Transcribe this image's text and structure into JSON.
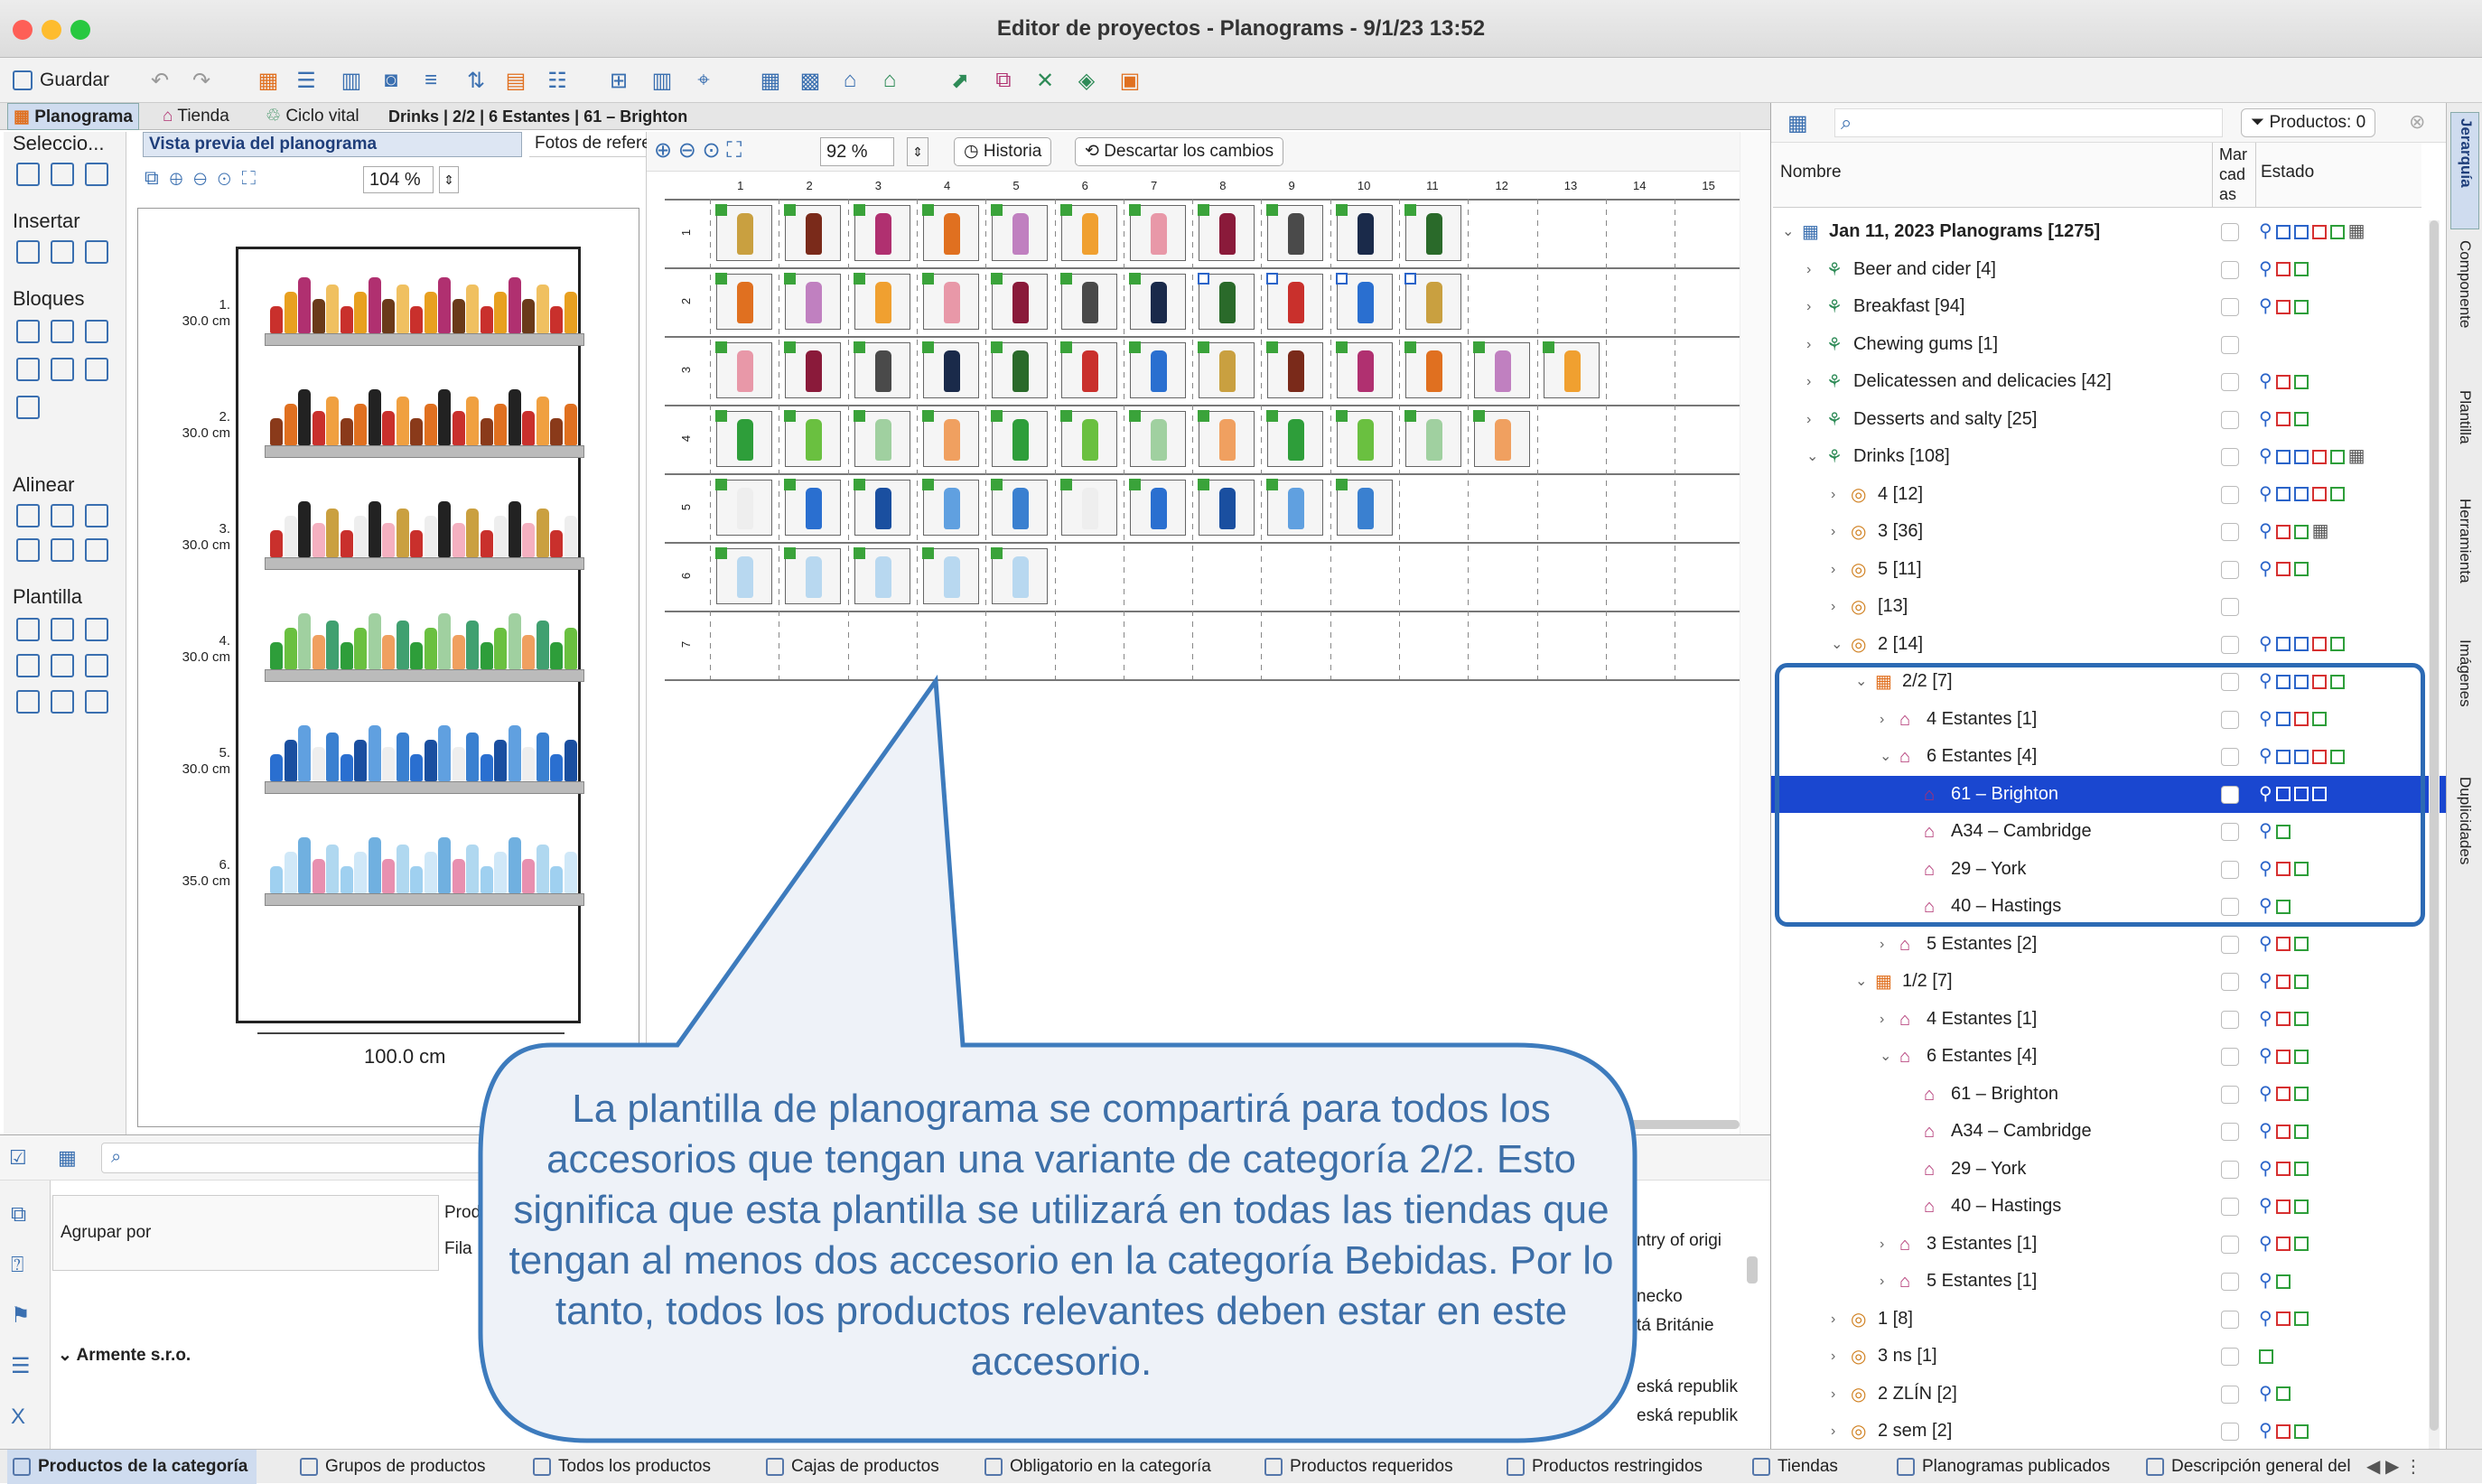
{
  "window": {
    "title": "Editor de proyectos - Planograms - 9/1/23 13:52"
  },
  "toolbar": {
    "save_label": "Guardar"
  },
  "tabs": {
    "planograma": "Planograma",
    "tienda": "Tienda",
    "ciclo": "Ciclo vital",
    "crumb": "Drinks | 2/2 | 6 Estantes | 61 – Brighton"
  },
  "palette": {
    "seleccion": "Seleccio...",
    "insertar": "Insertar",
    "bloques": "Bloques",
    "alinear": "Alinear",
    "plantilla": "Plantilla"
  },
  "preview": {
    "tab_active": "Vista previa del planograma",
    "tab_other": "Fotos de referencia",
    "zoom": "104 %",
    "width_label": "100.0 cm",
    "shelves": [
      {
        "n": "1.",
        "h": "30.0 cm"
      },
      {
        "n": "2.",
        "h": "30.0 cm"
      },
      {
        "n": "3.",
        "h": "30.0 cm"
      },
      {
        "n": "4.",
        "h": "30.0 cm"
      },
      {
        "n": "5.",
        "h": "30.0 cm"
      },
      {
        "n": "6.",
        "h": "35.0 cm"
      }
    ]
  },
  "canvas": {
    "zoom": "92 %",
    "historia": "Historia",
    "descartar": "Descartar los cambios",
    "cols": [
      "1",
      "2",
      "3",
      "4",
      "5",
      "6",
      "7",
      "8",
      "9",
      "10",
      "11",
      "12",
      "13",
      "14",
      "15"
    ],
    "rows": [
      "1",
      "2",
      "3",
      "4",
      "5",
      "6",
      "7"
    ],
    "row_counts": [
      11,
      11,
      13,
      12,
      10,
      5,
      0
    ]
  },
  "callout": {
    "text": "La plantilla de planograma se compartirá para todos los accesorios que tengan una variante de categoría 2/2. Esto significa que esta plantilla se utilizará en todas las tiendas que tengan al menos dos accesorio en la categoría Bebidas. Por lo tanto, todos los productos relevantes deben estar en este accesorio."
  },
  "right": {
    "productos": "Productos: 0",
    "col_nombre": "Nombre",
    "col_marcadas_1": "Mar",
    "col_marcadas_2": "cad",
    "col_marcadas_3": "as",
    "col_estado": "Estado",
    "tree": [
      {
        "label": "Jan 11, 2023 Planograms [1275]",
        "lvl": 0,
        "exp": "v",
        "bold": true,
        "icon": "root",
        "st": "BBRGT"
      },
      {
        "label": "Beer and cider [4]",
        "lvl": 1,
        "exp": ">",
        "icon": "cat",
        "st": "RG"
      },
      {
        "label": "Breakfast [94]",
        "lvl": 1,
        "exp": ">",
        "icon": "cat",
        "st": "RG"
      },
      {
        "label": "Chewing gums [1]",
        "lvl": 1,
        "exp": ">",
        "icon": "cat",
        "st": ""
      },
      {
        "label": "Delicatessen and delicacies [42]",
        "lvl": 1,
        "exp": ">",
        "icon": "cat",
        "st": "RG"
      },
      {
        "label": "Desserts and salty [25]",
        "lvl": 1,
        "exp": ">",
        "icon": "cat",
        "st": "RG"
      },
      {
        "label": "Drinks [108]",
        "lvl": 1,
        "exp": "v",
        "icon": "cat",
        "st": "BBRGT"
      },
      {
        "label": "4 [12]",
        "lvl": 2,
        "exp": ">",
        "icon": "var",
        "st": "BBRG"
      },
      {
        "label": "3 [36]",
        "lvl": 2,
        "exp": ">",
        "icon": "var",
        "st": "RGT"
      },
      {
        "label": "5 [11]",
        "lvl": 2,
        "exp": ">",
        "icon": "var",
        "st": "RG"
      },
      {
        "label": "[13]",
        "lvl": 2,
        "exp": ">",
        "icon": "var",
        "st": ""
      },
      {
        "label": "2 [14]",
        "lvl": 2,
        "exp": "v",
        "icon": "var",
        "st": "BBRG"
      },
      {
        "label": "2/2 [7]",
        "lvl": 3,
        "exp": "v",
        "icon": "tpl",
        "st": "BBRG"
      },
      {
        "label": "4 Estantes [1]",
        "lvl": 4,
        "exp": ">",
        "icon": "store",
        "st": "BRG"
      },
      {
        "label": "6 Estantes [4]",
        "lvl": 4,
        "exp": "v",
        "icon": "store",
        "st": "BBRG"
      },
      {
        "label": "61 – Brighton",
        "lvl": 5,
        "exp": "",
        "icon": "store",
        "st": "BBB",
        "sel": true
      },
      {
        "label": "A34 – Cambridge",
        "lvl": 5,
        "exp": "",
        "icon": "store",
        "st": "G"
      },
      {
        "label": "29 – York",
        "lvl": 5,
        "exp": "",
        "icon": "store",
        "st": "RG"
      },
      {
        "label": "40 – Hastings",
        "lvl": 5,
        "exp": "",
        "icon": "store",
        "st": "G"
      },
      {
        "label": "5 Estantes [2]",
        "lvl": 4,
        "exp": ">",
        "icon": "store",
        "st": "RG"
      },
      {
        "label": "1/2 [7]",
        "lvl": 3,
        "exp": "v",
        "icon": "tpl",
        "st": "RG"
      },
      {
        "label": "4 Estantes [1]",
        "lvl": 4,
        "exp": ">",
        "icon": "store",
        "st": "RG"
      },
      {
        "label": "6 Estantes [4]",
        "lvl": 4,
        "exp": "v",
        "icon": "store",
        "st": "RG"
      },
      {
        "label": "61 – Brighton",
        "lvl": 5,
        "exp": "",
        "icon": "store",
        "st": "RG"
      },
      {
        "label": "A34 – Cambridge",
        "lvl": 5,
        "exp": "",
        "icon": "store",
        "st": "RG"
      },
      {
        "label": "29 – York",
        "lvl": 5,
        "exp": "",
        "icon": "store",
        "st": "RG"
      },
      {
        "label": "40 – Hastings",
        "lvl": 5,
        "exp": "",
        "icon": "store",
        "st": "RG"
      },
      {
        "label": "3 Estantes [1]",
        "lvl": 4,
        "exp": ">",
        "icon": "store",
        "st": "RG"
      },
      {
        "label": "5 Estantes [1]",
        "lvl": 4,
        "exp": ">",
        "icon": "store",
        "st": "G"
      },
      {
        "label": "1 [8]",
        "lvl": 2,
        "exp": ">",
        "icon": "var",
        "st": "RG"
      },
      {
        "label": "3 ns [1]",
        "lvl": 2,
        "exp": ">",
        "icon": "var",
        "st": "G0"
      },
      {
        "label": "2 ZLÍN [2]",
        "lvl": 2,
        "exp": ">",
        "icon": "var",
        "st": "G"
      },
      {
        "label": "2 sem [2]",
        "lvl": 2,
        "exp": ">",
        "icon": "var",
        "st": "RG"
      }
    ]
  },
  "sidetabs": [
    "Jerarquía",
    "Componente",
    "Plantilla",
    "Herramienta",
    "Imágenes",
    "Duplicidades"
  ],
  "bottom": {
    "agrupar": "Agrupar por",
    "prod": "Prod",
    "fila": "Fila",
    "armente": "Armente s.r.o.",
    "country": "ntry of origi",
    "c1": "necko",
    "c2": "tá Británie",
    "c3": "eská republik",
    "c4": "eská republik"
  },
  "status": [
    "Productos de la categoría",
    "Grupos de productos",
    "Todos los productos",
    "Cajas de productos",
    "Obligatorio en la categoría",
    "Productos requeridos",
    "Productos restringidos",
    "Tiendas",
    "Planogramas publicados",
    "Descripción general del"
  ],
  "colors": {
    "accent": "#2b64c9",
    "callout_bg": "#eef2f8",
    "callout_border": "#3d7bbd",
    "callout_text": "#3d6fa8",
    "status_green": "#2e9e3a",
    "status_red": "#d63030"
  }
}
